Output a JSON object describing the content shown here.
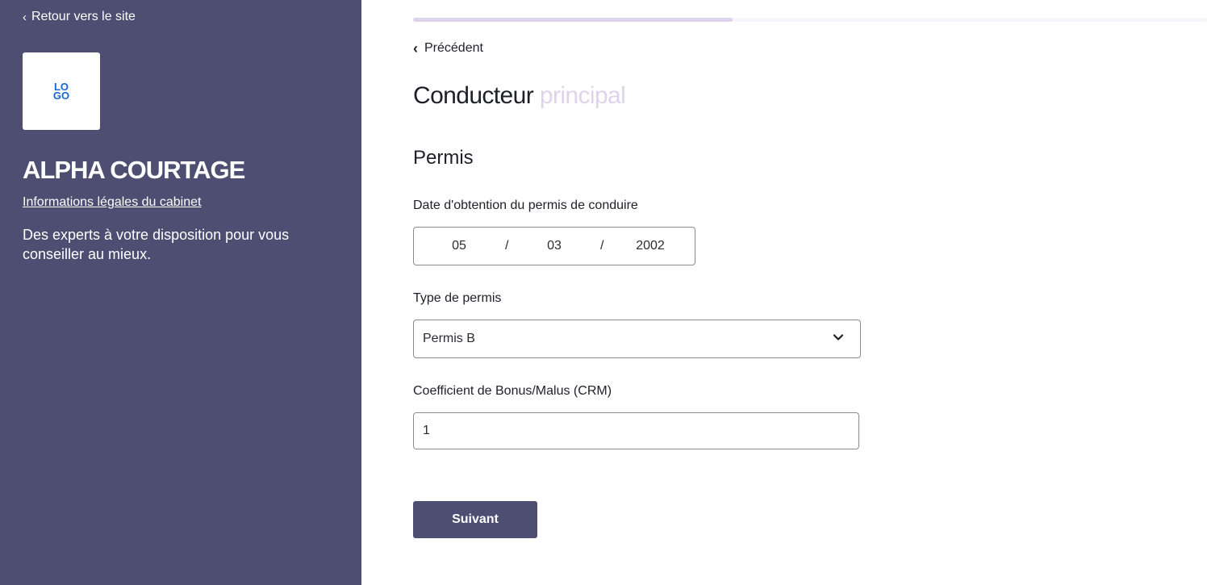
{
  "sidebar": {
    "back_label": "Retour vers le site",
    "logo_text": "LOGO",
    "company_name": "ALPHA COURTAGE",
    "legal_link": "Informations légales du cabinet",
    "tagline": "Des experts à votre disposition pour vous conseiller au mieux."
  },
  "progress": {
    "fraction": 0.402
  },
  "nav": {
    "previous_label": "Précédent"
  },
  "page": {
    "title_main": "Conducteur",
    "title_accent": "principal",
    "section_title": "Permis"
  },
  "form": {
    "license_date": {
      "label": "Date d'obtention du permis de conduire",
      "day": "05",
      "month": "03",
      "year": "2002",
      "separator": "/"
    },
    "license_type": {
      "label": "Type de permis",
      "selected": "Permis B"
    },
    "crm": {
      "label": "Coefficient de Bonus/Malus (CRM)",
      "value": "1"
    },
    "submit_label": "Suivant"
  },
  "colors": {
    "sidebar_bg": "#4d4e72",
    "accent": "#ddd4ec",
    "logo_blue": "#1565d8"
  },
  "icons": {
    "back": "chevron-left-icon",
    "select": "chevron-down-icon"
  }
}
